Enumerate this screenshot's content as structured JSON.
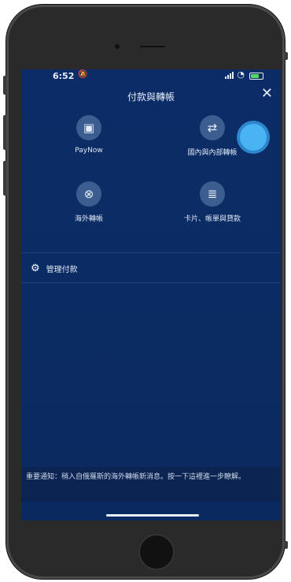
{
  "status_bar": {
    "time": "6:52"
  },
  "header": {
    "title": "付款與轉帳",
    "close_glyph": "✕"
  },
  "tiles": [
    {
      "label": "PayNow",
      "icon": "phone-pay-icon",
      "glyph": "▣"
    },
    {
      "label": "國內與內部轉帳",
      "icon": "transfer-arrows-icon",
      "glyph": "⇄"
    },
    {
      "label": "海外轉帳",
      "icon": "globe-icon",
      "glyph": "⊗"
    },
    {
      "label": "卡片、帳單與貸款",
      "icon": "bill-icon",
      "glyph": "≣"
    }
  ],
  "manage_payments": {
    "label": "管理付款"
  },
  "notice": {
    "text": "重要通知：稍入自俄羅斯的海外轉帳新消息。按一下這裡進一步瞭解。"
  },
  "colors": {
    "background": "#0b2c66",
    "accent": "#4ab3f2"
  }
}
